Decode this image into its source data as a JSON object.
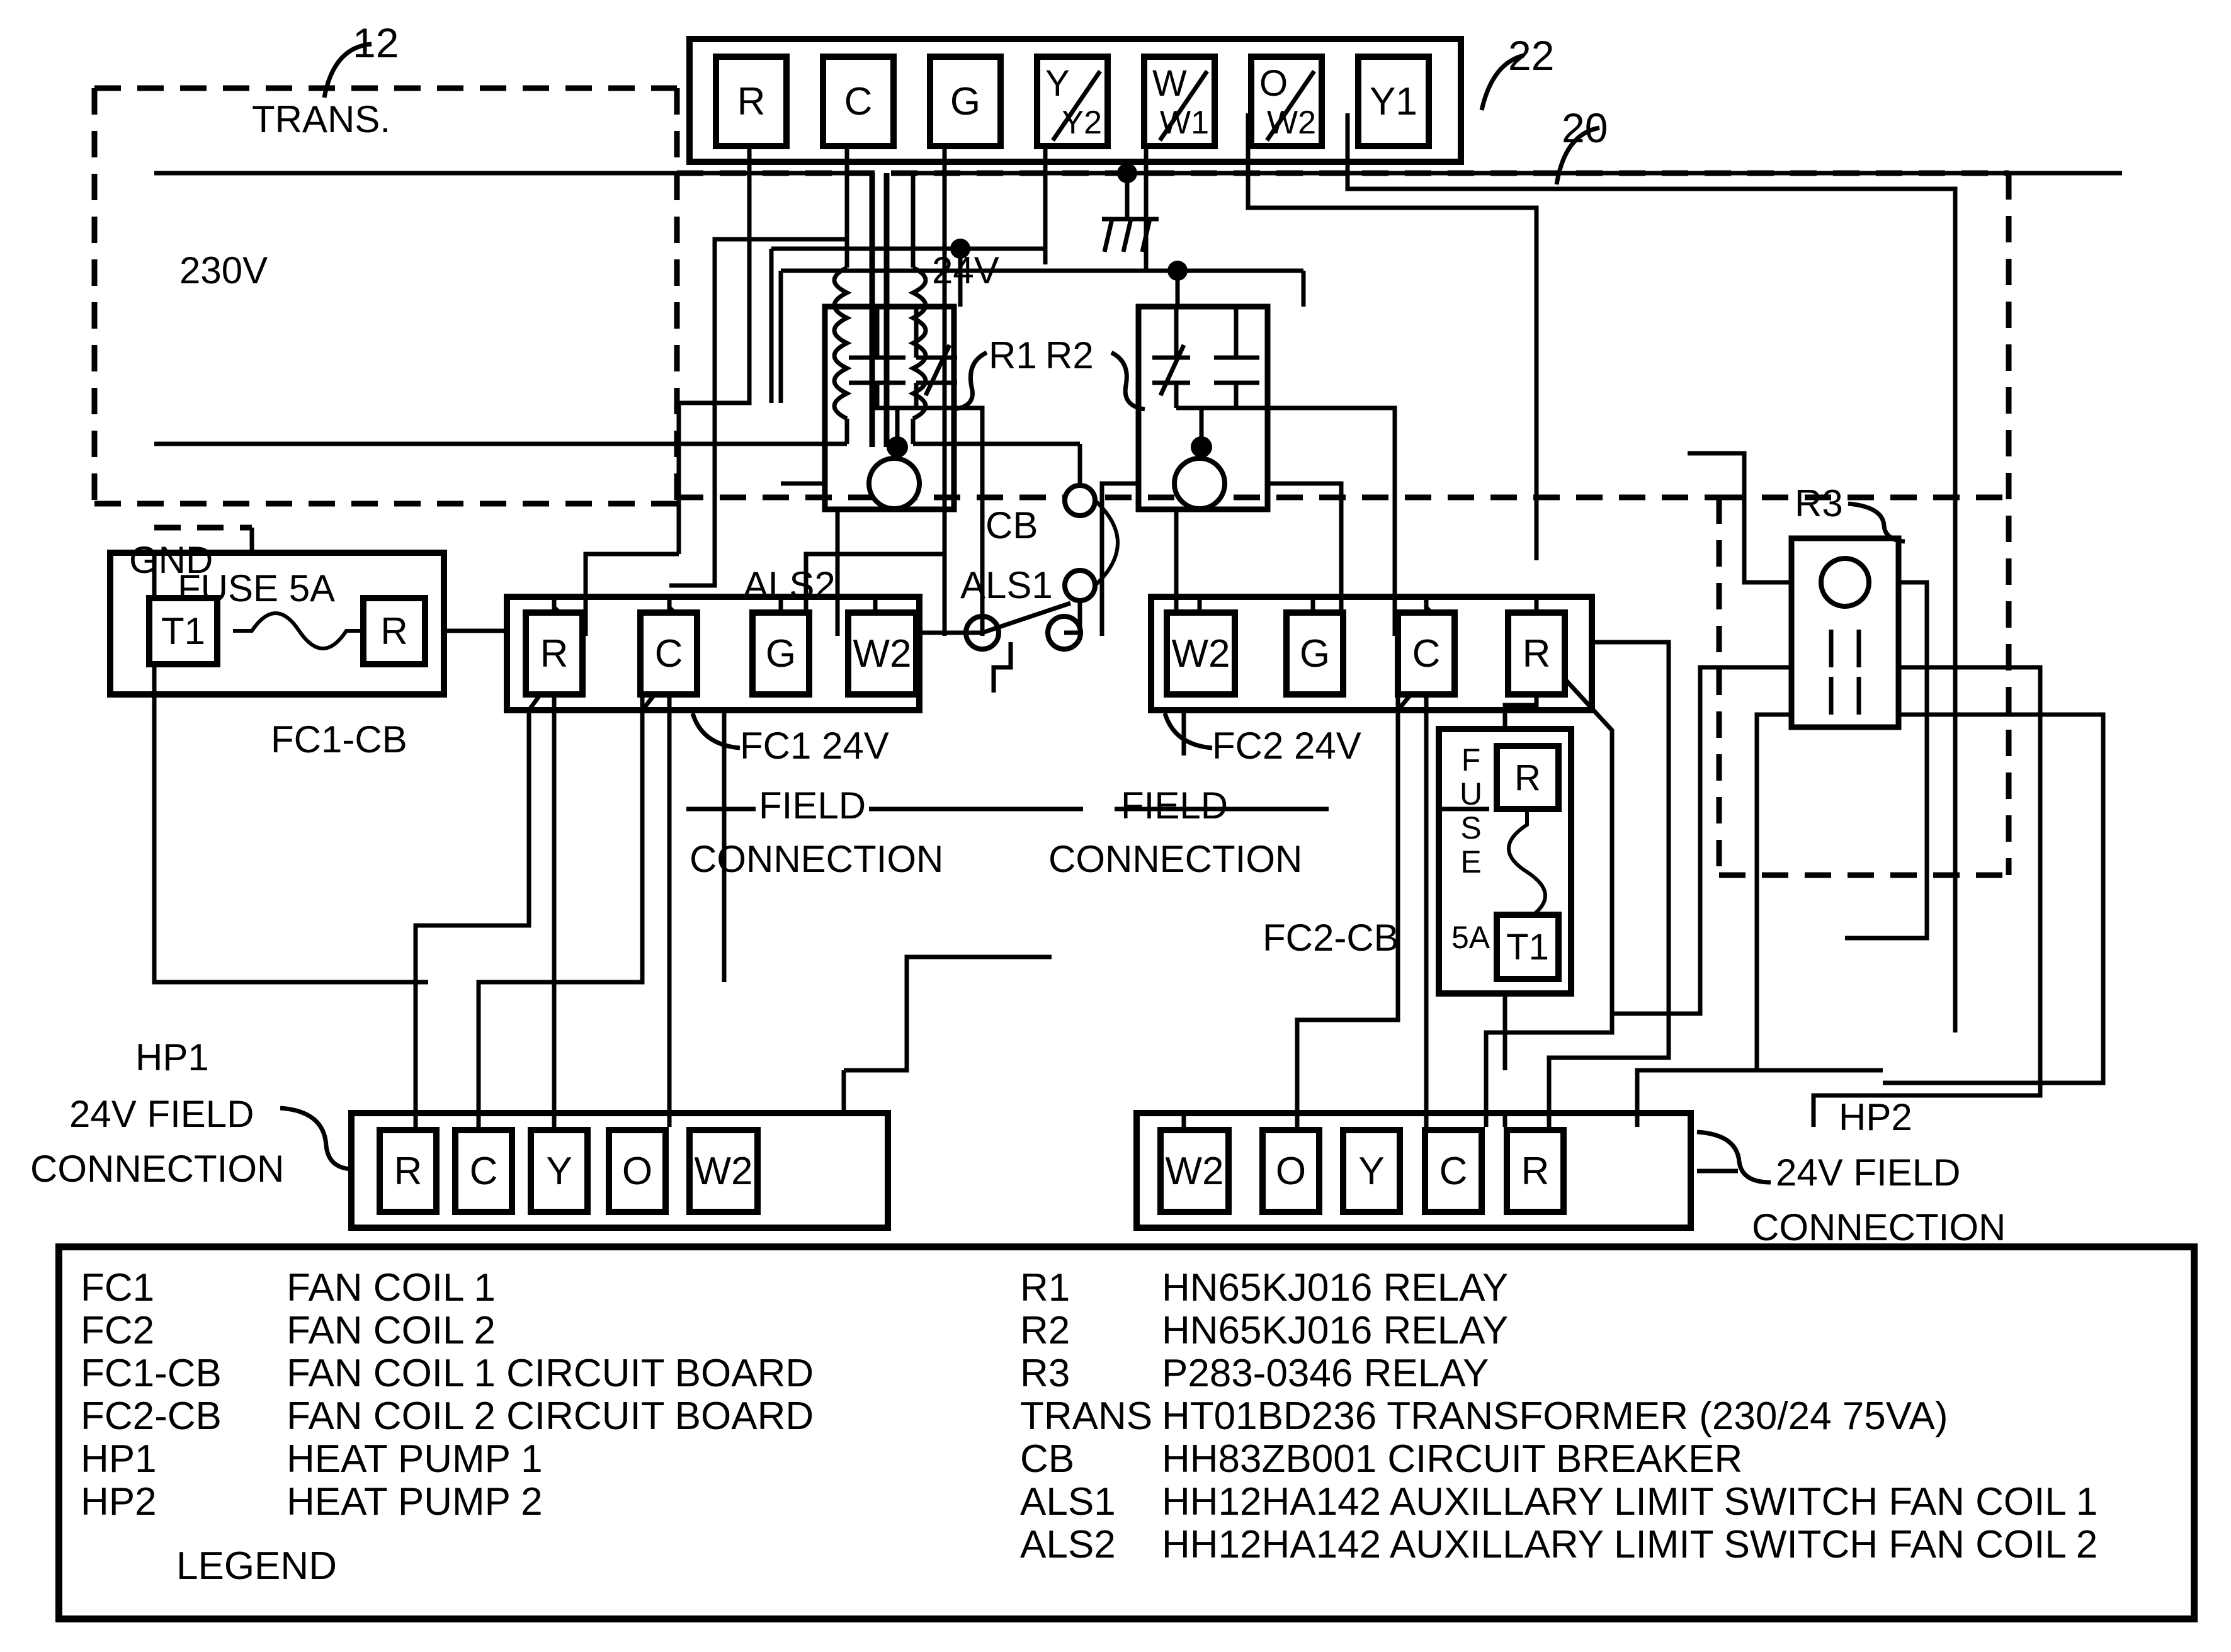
{
  "title": "HVAC dual fan coil / dual heat pump 24V control wiring diagram",
  "reference_numbers": {
    "transformer_box": "12",
    "outer_boundary": "20",
    "thermostat_strip": "22"
  },
  "transformer": {
    "label": "TRANS.",
    "primary": "230V",
    "secondary": "24V",
    "ground_label": "GND",
    "breaker": "CB",
    "limit_switch_1": "ALS1",
    "limit_switch_2": "ALS2"
  },
  "thermostat_strip": {
    "name": "22",
    "terminals": [
      {
        "top": "R",
        "bottom": ""
      },
      {
        "top": "C",
        "bottom": ""
      },
      {
        "top": "G",
        "bottom": ""
      },
      {
        "top": "Y",
        "bottom": "Y2"
      },
      {
        "top": "W",
        "bottom": "W1"
      },
      {
        "top": "O",
        "bottom": "W2"
      },
      {
        "top": "Y1",
        "bottom": ""
      }
    ]
  },
  "relays": {
    "r1": "R1",
    "r2": "R2",
    "r3": "R3"
  },
  "fc1_cb": {
    "label": "FC1-CB",
    "fuse_label": "FUSE 5A",
    "terminals": [
      "T1",
      "R"
    ]
  },
  "fc2_cb": {
    "label": "FC2-CB",
    "fuse_label_vertical": "FUSE",
    "fuse_rating": "5A",
    "terminals": [
      "R",
      "T1"
    ]
  },
  "fc1_block": {
    "title": "FC1  24V",
    "subtitle_line1": "FIELD",
    "subtitle_line2": "CONNECTION",
    "terminals": [
      "R",
      "C",
      "G",
      "W2"
    ]
  },
  "fc2_block": {
    "title": "FC2  24V",
    "subtitle_line1": "FIELD",
    "subtitle_line2": "CONNECTION",
    "terminals": [
      "W2",
      "G",
      "C",
      "R"
    ]
  },
  "hp1_block": {
    "name_line": "HP1",
    "sub_line1": "24V FIELD",
    "sub_line2": "CONNECTION",
    "terminals": [
      "R",
      "C",
      "Y",
      "O",
      "W2"
    ]
  },
  "hp2_block": {
    "name_line": "HP2",
    "sub_line1": "24V FIELD",
    "sub_line2": "CONNECTION",
    "terminals": [
      "W2",
      "O",
      "Y",
      "C",
      "R"
    ]
  },
  "legend": {
    "title": "LEGEND",
    "left_rows": [
      {
        "code": "FC1",
        "desc": "FAN COIL 1"
      },
      {
        "code": "FC2",
        "desc": "FAN COIL 2"
      },
      {
        "code": "FC1-CB",
        "desc": "FAN COIL 1 CIRCUIT BOARD"
      },
      {
        "code": "FC2-CB",
        "desc": "FAN COIL 2 CIRCUIT BOARD"
      },
      {
        "code": "HP1",
        "desc": "HEAT PUMP 1"
      },
      {
        "code": "HP2",
        "desc": "HEAT PUMP 2"
      }
    ],
    "right_rows": [
      {
        "code": "R1",
        "desc": "HN65KJ016 RELAY"
      },
      {
        "code": "R2",
        "desc": "HN65KJ016 RELAY"
      },
      {
        "code": "R3",
        "desc": "P283-0346 RELAY"
      },
      {
        "code": "TRANS",
        "desc": "HT01BD236 TRANSFORMER (230/24 75VA)"
      },
      {
        "code": "CB",
        "desc": "HH83ZB001 CIRCUIT BREAKER"
      },
      {
        "code": "ALS1",
        "desc": "HH12HA142 AUXILLARY LIMIT SWITCH FAN COIL 1"
      },
      {
        "code": "ALS2",
        "desc": "HH12HA142 AUXILLARY LIMIT SWITCH FAN COIL 2"
      }
    ]
  },
  "colors": {
    "ink": "#000000",
    "paper": "#ffffff"
  }
}
